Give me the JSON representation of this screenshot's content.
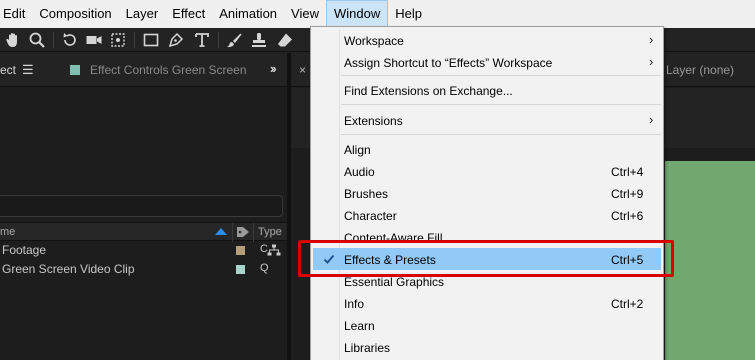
{
  "menubar": {
    "items": [
      "Edit",
      "Composition",
      "Layer",
      "Effect",
      "Animation",
      "View",
      "Window",
      "Help"
    ],
    "active": "Window"
  },
  "left_panel": {
    "tab_project": "ect",
    "tab_menu_icon": "hamburger-icon",
    "tab_effect_controls": "Effect Controls Green Screen Vi",
    "more_icon": "double-chevron-right-icon",
    "column_name": "me",
    "column_type": "Type",
    "rows": [
      {
        "name": "Footage",
        "type": "C",
        "label_color": "#b59f7a"
      },
      {
        "name": "Green Screen Video Clip",
        "type": "Q",
        "label_color": "#a9d4cc"
      }
    ]
  },
  "comp_panel": {
    "close_glyph": "×",
    "layer_tab": "Layer (none)",
    "green_color": "#71a870"
  },
  "dropdown": {
    "items": [
      {
        "label": "Workspace",
        "shortcut": "",
        "submenu": true
      },
      {
        "label": "Assign Shortcut to “Effects” Workspace",
        "shortcut": "",
        "submenu": true
      },
      {
        "label": "Find Extensions on Exchange...",
        "shortcut": "",
        "submenu": false
      },
      {
        "label": "Extensions",
        "shortcut": "",
        "submenu": true
      },
      {
        "label": "Align",
        "shortcut": "",
        "submenu": false
      },
      {
        "label": "Audio",
        "shortcut": "Ctrl+4",
        "submenu": false
      },
      {
        "label": "Brushes",
        "shortcut": "Ctrl+9",
        "submenu": false
      },
      {
        "label": "Character",
        "shortcut": "Ctrl+6",
        "submenu": false
      },
      {
        "label": "Content-Aware Fill",
        "shortcut": "",
        "submenu": false
      },
      {
        "label": "Effects & Presets",
        "shortcut": "Ctrl+5",
        "submenu": false,
        "checked": true,
        "highlighted": true
      },
      {
        "label": "Essential Graphics",
        "shortcut": "",
        "submenu": false
      },
      {
        "label": "Info",
        "shortcut": "Ctrl+2",
        "submenu": false
      },
      {
        "label": "Learn",
        "shortcut": "",
        "submenu": false
      },
      {
        "label": "Libraries",
        "shortcut": "",
        "submenu": false
      }
    ],
    "submenu_arrow": "›",
    "highlight_color": "#91c9f7",
    "annotation_color": "#d90000"
  }
}
